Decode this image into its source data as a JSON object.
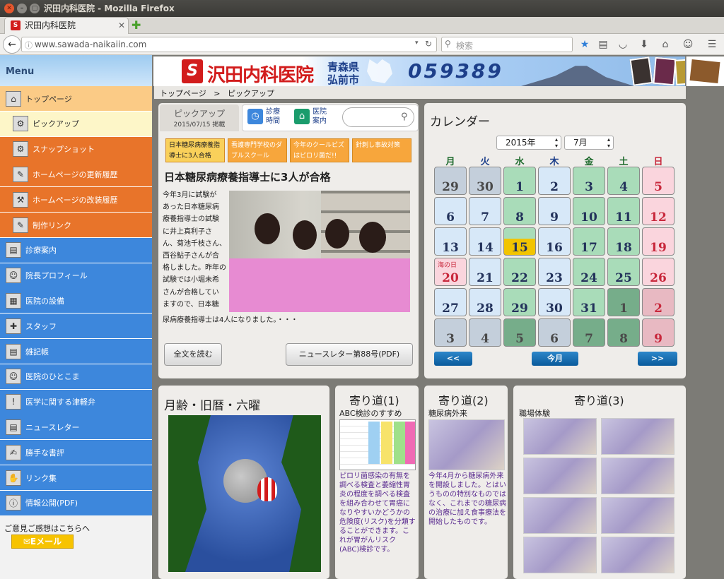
{
  "window": {
    "title": "沢田内科医院 - Mozilla Firefox",
    "tab_title": "沢田内科医院",
    "url": "www.sawada-naikaiin.com",
    "search_placeholder": "検索"
  },
  "sidebar": {
    "menu_label": "Menu",
    "items": [
      {
        "label": "トップページ",
        "icon": "home-icon"
      },
      {
        "label": "ピックアップ",
        "icon": "pickup-icon"
      },
      {
        "label": "スナップショット",
        "icon": "camera-icon"
      },
      {
        "label": "ホームページの更新履歴",
        "icon": "tool-icon"
      },
      {
        "label": "ホームページの改装履歴",
        "icon": "hammer-icon"
      },
      {
        "label": "制作リンク",
        "icon": "pencil-icon"
      },
      {
        "label": "診療案内",
        "icon": "clinic-icon"
      },
      {
        "label": "院長プロフィール",
        "icon": "doctor-icon"
      },
      {
        "label": "医院の設備",
        "icon": "equipment-icon"
      },
      {
        "label": "スタッフ",
        "icon": "nurse-icon"
      },
      {
        "label": "雑記帳",
        "icon": "notebook-icon"
      },
      {
        "label": "医院のひとこま",
        "icon": "photo-icon"
      },
      {
        "label": "医学に関する津軽弁",
        "icon": "speech-icon"
      },
      {
        "label": "ニュースレター",
        "icon": "newsletter-icon"
      },
      {
        "label": "勝手な書評",
        "icon": "book-icon"
      },
      {
        "label": "リンク集",
        "icon": "handshake-icon"
      },
      {
        "label": "情報公開(PDF)",
        "icon": "info-icon"
      }
    ],
    "feedback_text": "ご意見ご感想はこちらへ",
    "email_button": "Eメール"
  },
  "banner": {
    "site_name": "沢田内科医院",
    "pref": "青森県",
    "city": "弘前市",
    "phone": "059389"
  },
  "breadcrumb": {
    "home": "トップページ",
    "sep": ">",
    "current": "ピックアップ"
  },
  "pickup": {
    "tab_label": "ピックアップ",
    "date": "2015/07/15 掲載",
    "link1_l1": "診療",
    "link1_l2": "時間",
    "link2_l1": "医院",
    "link2_l2": "案内",
    "tags": [
      "日本糖尿病療養指導士に3人合格",
      "看護専門学校のダブルスクール",
      "今年のクールビズはピロリ菌だ!!",
      "針刺し事故対策"
    ],
    "headline": "日本糖尿病療養指導士に3人が合格",
    "body_lines": [
      "今年3月に試験が",
      "あった日本糖尿病",
      "療養指導士の試験",
      "に井上真利子さ",
      "ん、菊池千枝さん、",
      "西谷鮎子さんが合",
      "格しました。昨年の",
      "試験では小堀未希",
      "さんが合格してい",
      "ますので、日本糖"
    ],
    "body_last": "尿病療養指導士は4人になりました。・・・",
    "read_more": "全文を読む",
    "newsletter": "ニュースレター第88号(PDF)"
  },
  "calendar": {
    "title": "カレンダー",
    "year": "2015年",
    "month": "7月",
    "dow": [
      "月",
      "火",
      "水",
      "木",
      "金",
      "土",
      "日"
    ],
    "weeks": [
      [
        "29",
        "30",
        "1",
        "2",
        "3",
        "4",
        "5"
      ],
      [
        "6",
        "7",
        "8",
        "9",
        "10",
        "11",
        "12"
      ],
      [
        "13",
        "14",
        "15",
        "16",
        "17",
        "18",
        "19"
      ],
      [
        "20",
        "21",
        "22",
        "23",
        "24",
        "25",
        "26"
      ],
      [
        "27",
        "28",
        "29",
        "30",
        "31",
        "1",
        "2"
      ],
      [
        "3",
        "4",
        "5",
        "6",
        "7",
        "8",
        "9"
      ]
    ],
    "holiday_label": "海の日",
    "prev": "<<",
    "today": "今月",
    "next": ">>"
  },
  "moon": {
    "title": "月齢・旧暦・六曜"
  },
  "yorimichi1": {
    "title": "寄り道(1)",
    "subtitle": "ABC検診のすすめ",
    "text": "ピロリ菌感染の有無を調べる検査と萎縮性胃炎の程度を調べる検査を組み合わせて胃癌になりやすいかどうかの危険度(リスク)を分類することができます。これが胃がんリスク(ABC)検診です。"
  },
  "yorimichi2": {
    "title": "寄り道(2)",
    "subtitle": "糖尿病外来",
    "text": "今年4月から糖尿病外来を開設しました。とはいうものの特別なものではなく、これまでの糖尿病の治療に加え食事療法を開始したものです。"
  },
  "yorimichi3": {
    "title": "寄り道(3)",
    "subtitle": "職場体験"
  },
  "colors": {
    "accent": "#e8742a",
    "nav_blue": "#3d87dc",
    "cal_green": "#a9dcb9",
    "cal_blue": "#d7e8f8",
    "cal_pink": "#fad5dd",
    "cal_today": "#f2c400"
  }
}
